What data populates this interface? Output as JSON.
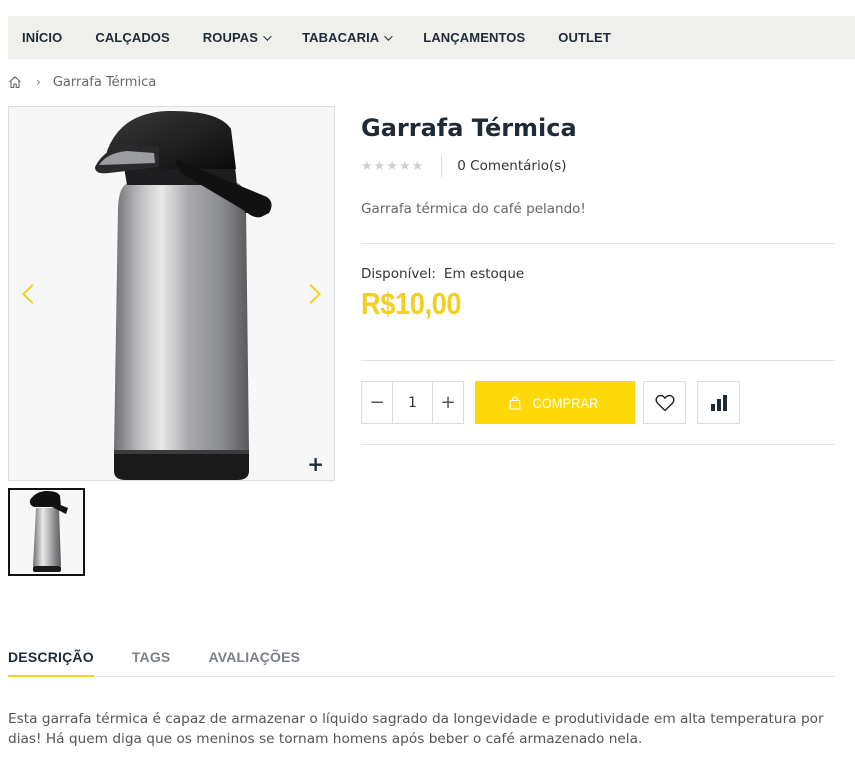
{
  "nav": {
    "items": [
      {
        "label": "INÍCIO",
        "has_dropdown": false
      },
      {
        "label": "CALÇADOS",
        "has_dropdown": false
      },
      {
        "label": "ROUPAS",
        "has_dropdown": true
      },
      {
        "label": "TABACARIA",
        "has_dropdown": true
      },
      {
        "label": "LANÇAMENTOS",
        "has_dropdown": false
      },
      {
        "label": "OUTLET",
        "has_dropdown": false
      }
    ]
  },
  "breadcrumb": {
    "home_icon": "home-icon",
    "separator": "›",
    "current": "Garrafa Térmica"
  },
  "gallery": {
    "zoom_symbol": "+",
    "main_image": "thermos-product-image",
    "thumbnails": [
      "thermos-thumbnail"
    ]
  },
  "product": {
    "title": "Garrafa Térmica",
    "rating": 0,
    "stars": "★★★★★",
    "comments": "0 Comentário(s)",
    "short_description": "Garrafa térmica do café pelando!",
    "availability_label": "Disponível:",
    "availability_value": "Em estoque",
    "price": "R$10,00",
    "quantity": "1",
    "minus": "−",
    "plus": "+",
    "buy_label": "COMPRAR"
  },
  "tabs": {
    "items": [
      {
        "label": "DESCRIÇÃO",
        "active": true
      },
      {
        "label": "TAGS",
        "active": false
      },
      {
        "label": "AVALIAÇÕES",
        "active": false
      }
    ]
  },
  "description": {
    "text": "Esta garrafa térmica é capaz de armazenar o líquido sagrado da longevidade e produtividade em alta temperatura por dias! Há quem diga que os meninos se tornam homens após beber o café armazenado nela."
  },
  "colors": {
    "accent": "#f3cf20",
    "buy_button": "#fdd90a",
    "nav_bg": "#efefec",
    "heading": "#1e2a36"
  }
}
